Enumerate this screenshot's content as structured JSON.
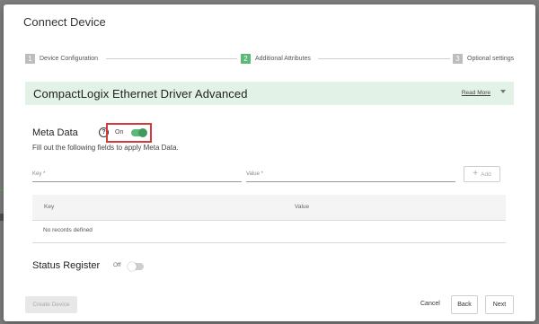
{
  "dialog": {
    "title": "Connect Device"
  },
  "stepper": {
    "steps": [
      {
        "number": "1",
        "label": "Device Configuration",
        "state": "done"
      },
      {
        "number": "2",
        "label": "Additional Attributes",
        "state": "active"
      },
      {
        "number": "3",
        "label": "Optional settings",
        "state": "pending"
      }
    ]
  },
  "driver": {
    "name": "CompactLogix Ethernet Driver Advanced",
    "read_more": "Read More",
    "expand_icon": "chevron-down-icon"
  },
  "meta": {
    "label": "Meta Data",
    "help_icon": "help-circle-icon",
    "help_glyph": "?",
    "toggle_label": "On",
    "enabled": true,
    "description": "Fill out the following fields to apply Meta Data.",
    "key_placeholder": "Key *",
    "value_placeholder": "Value *",
    "add_icon": "plus-icon",
    "add_glyph": "+",
    "add_label": "Add",
    "table": {
      "columns": [
        "Key",
        "Value"
      ],
      "empty_text": "No records defined"
    }
  },
  "status_register": {
    "label": "Status Register",
    "toggle_label": "Off",
    "enabled": false
  },
  "footer": {
    "create_label": "Create Device",
    "cancel_label": "Cancel",
    "back_label": "Back",
    "next_label": "Next"
  },
  "colors": {
    "accent": "#5cb878",
    "driver_bar_bg": "#e3f2e6",
    "highlight_border": "#d33b3b"
  }
}
